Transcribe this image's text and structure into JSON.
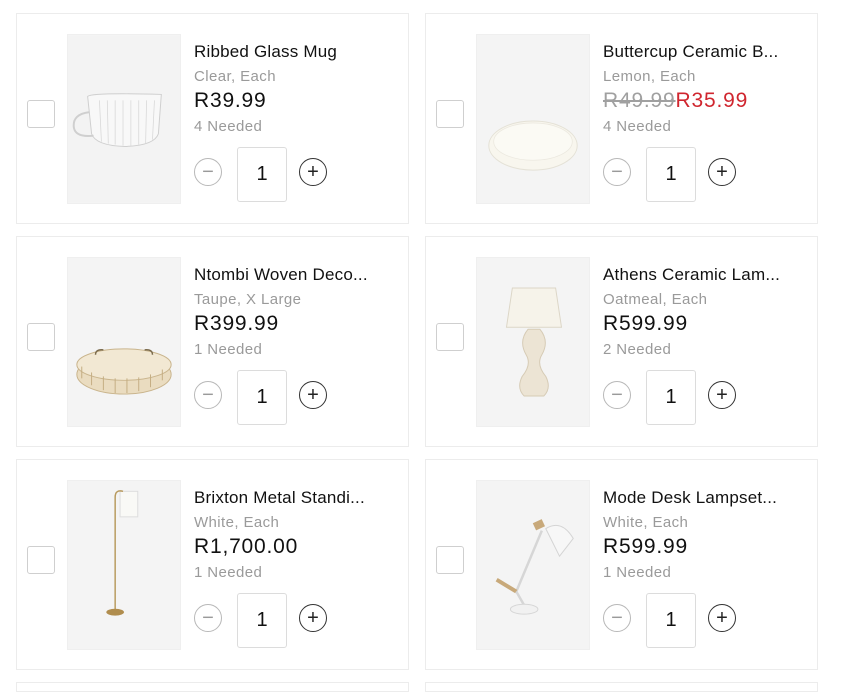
{
  "items": [
    {
      "name": "Ribbed Glass Mug",
      "variant": "Clear, Each",
      "price": "R39.99",
      "old_price": "",
      "sale_price": "",
      "needed": "4 Needed",
      "quantity": "1",
      "image": "glass-mug"
    },
    {
      "name": "Buttercup Ceramic B...",
      "variant": "Lemon, Each",
      "price": "",
      "old_price": "R49.99",
      "sale_price": "R35.99",
      "needed": "4 Needed",
      "quantity": "1",
      "image": "ceramic-bowl",
      "sale_color": "#d0262f"
    },
    {
      "name": "Ntombi Woven Deco...",
      "variant": "Taupe, X Large",
      "price": "R399.99",
      "old_price": "",
      "sale_price": "",
      "needed": "1 Needed",
      "quantity": "1",
      "image": "woven-tray"
    },
    {
      "name": "Athens Ceramic Lam...",
      "variant": "Oatmeal, Each",
      "price": "R599.99",
      "old_price": "",
      "sale_price": "",
      "needed": "2 Needed",
      "quantity": "1",
      "image": "table-lamp"
    },
    {
      "name": "Brixton Metal Standi...",
      "variant": "White, Each",
      "price": "R1,700.00",
      "old_price": "",
      "sale_price": "",
      "needed": "1 Needed",
      "quantity": "1",
      "image": "floor-lamp"
    },
    {
      "name": "Mode Desk Lampset...",
      "variant": "White, Each",
      "price": "R599.99",
      "old_price": "",
      "sale_price": "",
      "needed": "1 Needed",
      "quantity": "1",
      "image": "desk-lamp"
    }
  ],
  "controls": {
    "minus_icon": "minus-icon",
    "plus_icon": "plus-icon",
    "minus_glyph": "−",
    "plus_glyph": "+"
  }
}
